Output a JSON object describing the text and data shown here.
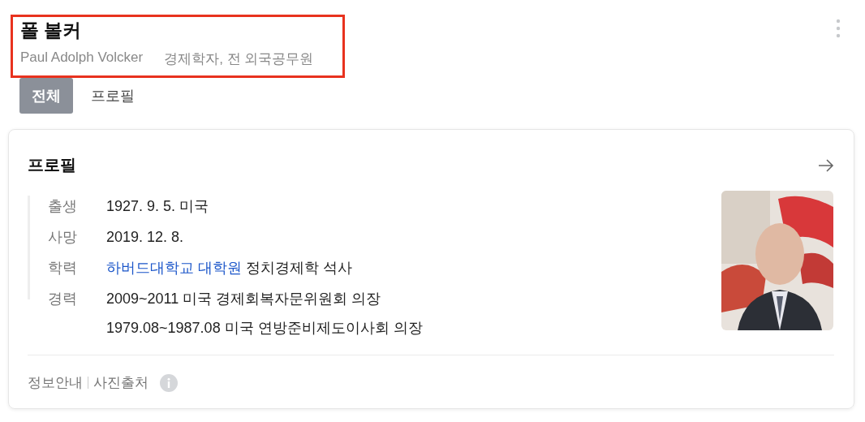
{
  "header": {
    "title": "폴 볼커",
    "name_en": "Paul Adolph Volcker",
    "description": "경제학자, 전 외국공무원",
    "highlighted": true
  },
  "tabs": [
    {
      "label": "전체",
      "selected": true
    },
    {
      "label": "프로필",
      "selected": false
    }
  ],
  "profile_card": {
    "title": "프로필",
    "rows": [
      {
        "label": "출생",
        "lines": [
          [
            {
              "text": "1927. 9. 5. 미국",
              "link": false
            }
          ]
        ]
      },
      {
        "label": "사망",
        "lines": [
          [
            {
              "text": "2019. 12. 8.",
              "link": false
            }
          ]
        ]
      },
      {
        "label": "학력",
        "lines": [
          [
            {
              "text": "하버드대학교 대학원",
              "link": true
            },
            {
              "text": "정치경제학 석사",
              "link": false
            }
          ]
        ]
      },
      {
        "label": "경력",
        "lines": [
          [
            {
              "text": "2009~2011 미국 경제회복자문위원회 의장",
              "link": false
            }
          ],
          [
            {
              "text": "1979.08~1987.08 미국 연방준비제도이사회 의장",
              "link": false
            }
          ]
        ]
      }
    ],
    "footer_links": [
      "정보안내",
      "사진출처"
    ]
  }
}
